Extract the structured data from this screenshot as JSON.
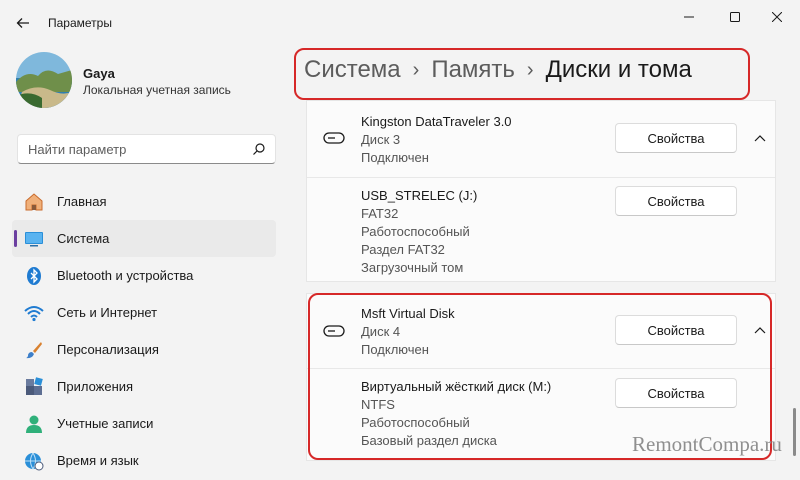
{
  "window": {
    "title": "Параметры"
  },
  "profile": {
    "name": "Gaya",
    "account_type": "Локальная учетная запись"
  },
  "search": {
    "placeholder": "Найти параметр"
  },
  "nav": {
    "items": [
      {
        "label": "Главная",
        "icon": "home-icon",
        "active": false
      },
      {
        "label": "Система",
        "icon": "system-icon",
        "active": true
      },
      {
        "label": "Bluetooth и устройства",
        "icon": "bluetooth-icon",
        "active": false
      },
      {
        "label": "Сеть и Интернет",
        "icon": "wifi-icon",
        "active": false
      },
      {
        "label": "Персонализация",
        "icon": "brush-icon",
        "active": false
      },
      {
        "label": "Приложения",
        "icon": "apps-icon",
        "active": false
      },
      {
        "label": "Учетные записи",
        "icon": "account-icon",
        "active": false
      },
      {
        "label": "Время и язык",
        "icon": "globe-clock-icon",
        "active": false
      }
    ]
  },
  "breadcrumb": {
    "items": [
      "Система",
      "Память",
      "Диски и тома"
    ]
  },
  "disks": [
    {
      "name": "Kingston DataTraveler 3.0",
      "disk": "Диск 3",
      "status": "Подключен",
      "button": "Свойства",
      "volume": {
        "name": "USB_STRELEC (J:)",
        "lines": [
          "FAT32",
          "Работоспособный",
          "Раздел FAT32",
          "Загрузочный том"
        ],
        "button": "Свойства"
      }
    },
    {
      "name": "Msft Virtual Disk",
      "disk": "Диск 4",
      "status": "Подключен",
      "button": "Свойства",
      "volume": {
        "name": "Виртуальный жёсткий диск (M:)",
        "lines": [
          "NTFS",
          "Работоспособный",
          "Базовый раздел диска"
        ],
        "button": "Свойства"
      }
    }
  ],
  "watermark": "RemontCompa.ru",
  "colors": {
    "accent": "#6b3fa0",
    "highlight_box": "#d62828",
    "background": "#f3f3f3",
    "card": "#fbfbfb"
  }
}
